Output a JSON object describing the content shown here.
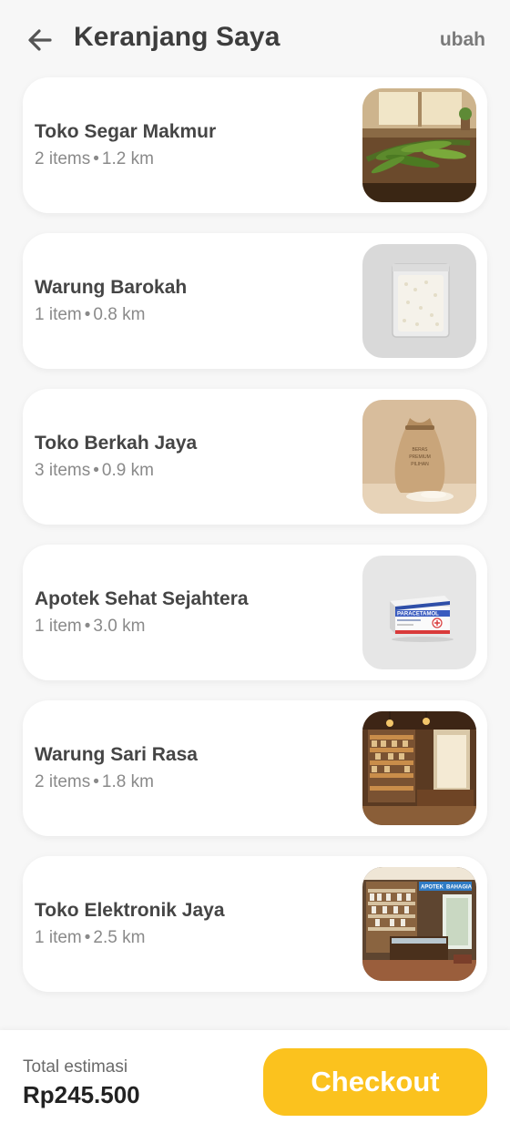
{
  "header": {
    "back_icon": "arrow-left-icon",
    "title": "Keranjang Saya",
    "edit_label": "ubah"
  },
  "stores": [
    {
      "name": "Toko Segar Makmur",
      "count": "2 items",
      "distance": "1.2 km",
      "image": "leafy-herbs-on-wooden-table"
    },
    {
      "name": "Warung Barokah",
      "count": "1 item",
      "distance": "0.8 km",
      "image": "rice-in-plastic-bag"
    },
    {
      "name": "Toko Berkah Jaya",
      "count": "3 items",
      "distance": "0.9 km",
      "image": "burlap-rice-sack"
    },
    {
      "name": "Apotek Sehat Sejahtera",
      "count": "1 item",
      "distance": "3.0 km",
      "image": "paracetamol-box"
    },
    {
      "name": "Warung Sari Rasa",
      "count": "2 items",
      "distance": "1.8 km",
      "image": "grocery-store-interior"
    },
    {
      "name": "Toko Elektronik Jaya",
      "count": "1 item",
      "distance": "2.5 km",
      "image": "pharmacy-store-interior"
    }
  ],
  "image_text": {
    "paracetamol": "PARACETAMOL",
    "apotek": "APOTEK",
    "sign": "BAHAGIA",
    "sack_lines": [
      "BERAS",
      "PREMIUM",
      "PILIHAN"
    ]
  },
  "footer": {
    "total_label": "Total estimasi",
    "total_value": "Rp245.500",
    "checkout_label": "Checkout"
  },
  "colors": {
    "accent": "#fbc21e",
    "background": "#f7f7f7",
    "card": "#ffffff"
  }
}
